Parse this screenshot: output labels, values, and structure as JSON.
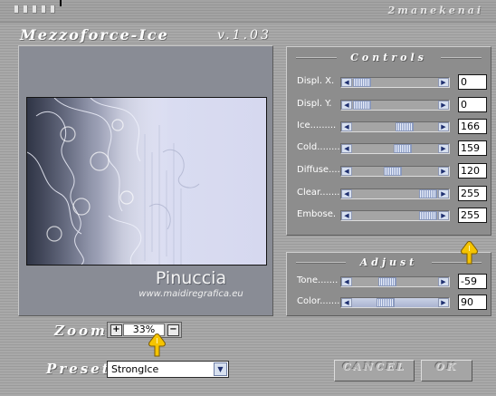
{
  "window": {
    "title": "Mezzoforce-Ice",
    "version": "v.1.03",
    "author": "2manekenai"
  },
  "preview": {
    "watermark_name": "Pinuccia",
    "watermark_url": "www.maidiregrafica.eu"
  },
  "controls": {
    "title": "Controls",
    "sliders": [
      {
        "label": "Displ. X.",
        "value": "0",
        "fraction": 0.0
      },
      {
        "label": "Displ. Y.",
        "value": "0",
        "fraction": 0.0
      },
      {
        "label": "Ice.........",
        "value": "166",
        "fraction": 0.65
      },
      {
        "label": "Cold........",
        "value": "159",
        "fraction": 0.62
      },
      {
        "label": "Diffuse.....",
        "value": "120",
        "fraction": 0.47
      },
      {
        "label": "Clear.......",
        "value": "255",
        "fraction": 1.0
      },
      {
        "label": "Embose.",
        "value": "255",
        "fraction": 1.0
      }
    ]
  },
  "adjust": {
    "title": "Adjust",
    "sliders": [
      {
        "label": "Tone.......",
        "value": "-59",
        "fraction": 0.38
      },
      {
        "label": "Color.......",
        "value": "90",
        "fraction": 0.35
      }
    ]
  },
  "zoom": {
    "label": "Zoom",
    "value": "33%",
    "plus": "+",
    "minus": "−"
  },
  "preset": {
    "label": "Preset",
    "selected": "StrongIce"
  },
  "buttons": {
    "cancel": "CANCEL",
    "ok": "OK"
  },
  "colors": {
    "pointer_hand": "#f5c400"
  }
}
